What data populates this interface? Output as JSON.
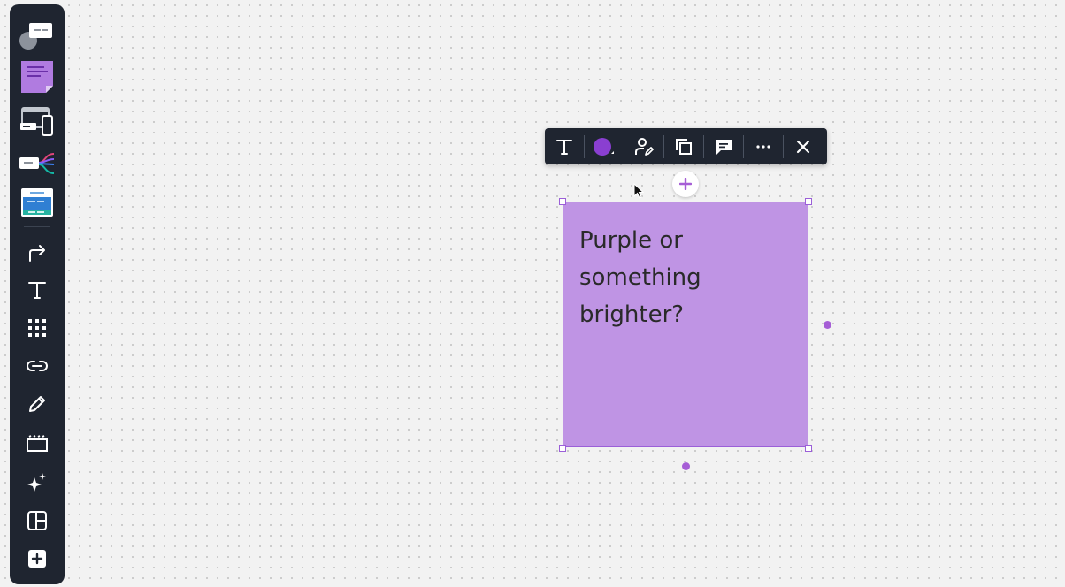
{
  "toolbar": {
    "items": [
      {
        "name": "comment-template",
        "icon": "comment-card-icon"
      },
      {
        "name": "sticky-note",
        "icon": "sticky-note-icon"
      },
      {
        "name": "wireframe",
        "icon": "devices-icon"
      },
      {
        "name": "mind-map",
        "icon": "mind-map-icon"
      },
      {
        "name": "card-template",
        "icon": "card-template-icon"
      },
      {
        "name": "connection-line",
        "icon": "arrow-turn-icon"
      },
      {
        "name": "text",
        "icon": "text-icon"
      },
      {
        "name": "apps-grid",
        "icon": "grid-icon"
      },
      {
        "name": "link",
        "icon": "link-icon"
      },
      {
        "name": "pen",
        "icon": "pen-icon"
      },
      {
        "name": "frame",
        "icon": "frame-icon"
      },
      {
        "name": "ai-assist",
        "icon": "sparkle-icon"
      },
      {
        "name": "layout",
        "icon": "layout-icon"
      },
      {
        "name": "more-tools",
        "icon": "plus-square-icon"
      }
    ]
  },
  "context_toolbar": {
    "buttons": [
      "text-format",
      "color",
      "assign",
      "duplicate",
      "comment",
      "more",
      "close"
    ],
    "selected_color": "#8a3fd1"
  },
  "sticky_note": {
    "text": "Purple or something brighter?",
    "color": "#bf94e4",
    "border_color": "#9b5fd8"
  }
}
